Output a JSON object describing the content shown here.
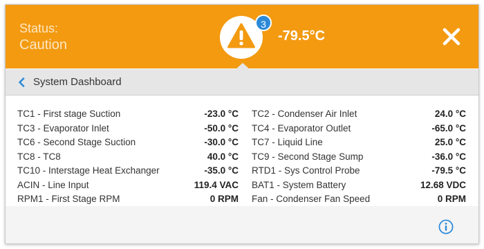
{
  "header": {
    "status_label": "Status:",
    "status_value": "Caution",
    "alert_count": "3",
    "alert_temperature": "-79.5°C",
    "accent_color": "#f39a11",
    "badge_color": "#2d8ad8"
  },
  "nav": {
    "title": "System Dashboard"
  },
  "readings": {
    "left": [
      {
        "name": "TC1 - First stage Suction",
        "value": "-23.0 °C"
      },
      {
        "name": "TC3 - Evaporator Inlet",
        "value": "-50.0 °C"
      },
      {
        "name": "TC6 - Second Stage Suction",
        "value": "-30.0 °C"
      },
      {
        "name": "TC8 - TC8",
        "value": "40.0 °C"
      },
      {
        "name": "TC10 - Interstage Heat Exchanger",
        "value": "-35.0 °C"
      },
      {
        "name": "ACIN - Line Input",
        "value": "119.4 VAC"
      },
      {
        "name": "RPM1 - First Stage RPM",
        "value": "0 RPM"
      }
    ],
    "right": [
      {
        "name": "TC2 - Condenser Air Inlet",
        "value": "24.0 °C"
      },
      {
        "name": "TC4 - Evaporator Outlet",
        "value": "-65.0 °C"
      },
      {
        "name": "TC7 - Liquid Line",
        "value": "25.0 °C"
      },
      {
        "name": "TC9 - Second Stage Sump",
        "value": "-36.0 °C"
      },
      {
        "name": "RTD1 - Sys Control Probe",
        "value": "-79.5 °C"
      },
      {
        "name": "BAT1 - System Battery",
        "value": "12.68 VDC"
      },
      {
        "name": "Fan - Condenser Fan Speed",
        "value": "0 RPM"
      }
    ]
  },
  "icons": {
    "alert": "warning-triangle-icon",
    "close": "close-icon",
    "back": "chevron-left-icon",
    "info": "info-icon"
  }
}
